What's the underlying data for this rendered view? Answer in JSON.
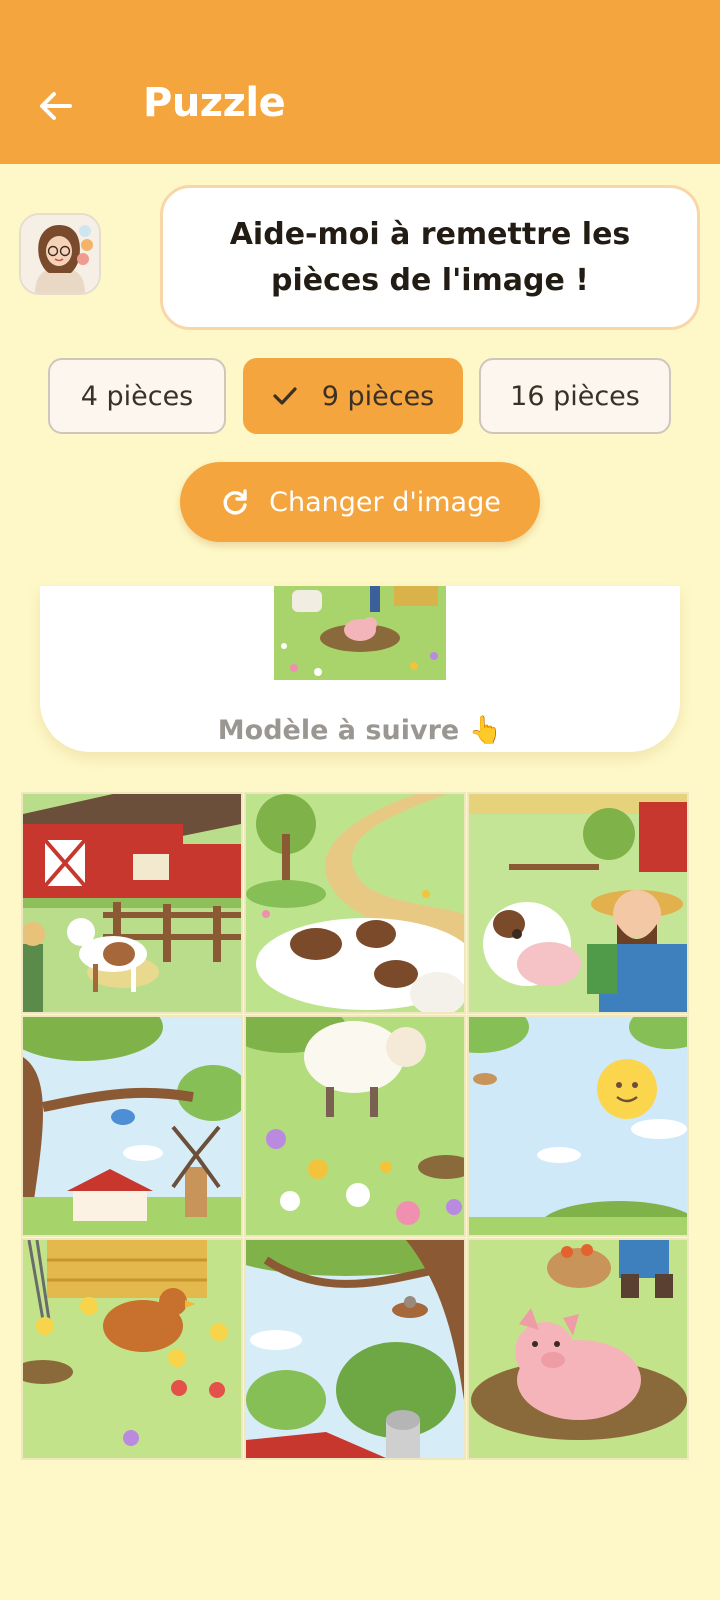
{
  "appbar": {
    "title": "Puzzle",
    "back_icon": "arrow-left-icon"
  },
  "helper": {
    "avatar_icon": "teacher-avatar-icon",
    "message": "Aide-moi à remettre les pièces de l'image !"
  },
  "difficulty": {
    "options": [
      {
        "label": "4 pièces",
        "selected": false
      },
      {
        "label": "9 pièces",
        "selected": true
      },
      {
        "label": "16 pièces",
        "selected": false
      }
    ],
    "check_icon": "check-icon"
  },
  "change_button": {
    "label": "Changer d'image",
    "icon": "refresh-icon"
  },
  "model": {
    "label": "Modèle à suivre 👆",
    "image_description": "farm-scene-thumbnail"
  },
  "puzzle": {
    "pieces": [
      {
        "description": "red barn with goat and fence"
      },
      {
        "description": "cow on path with sheep"
      },
      {
        "description": "cow and smiling farmer"
      },
      {
        "description": "tree with bird, house and windmill"
      },
      {
        "description": "sheep among flowers"
      },
      {
        "description": "sky with smiling sun and bird"
      },
      {
        "description": "hay bales, hen and chicks"
      },
      {
        "description": "tree with bird nest and silo"
      },
      {
        "description": "pig in mud with vegetable basket"
      }
    ]
  },
  "colors": {
    "primary": "#f4a53d",
    "background": "#fef8c8",
    "bubble_border": "#f9d6a8"
  }
}
